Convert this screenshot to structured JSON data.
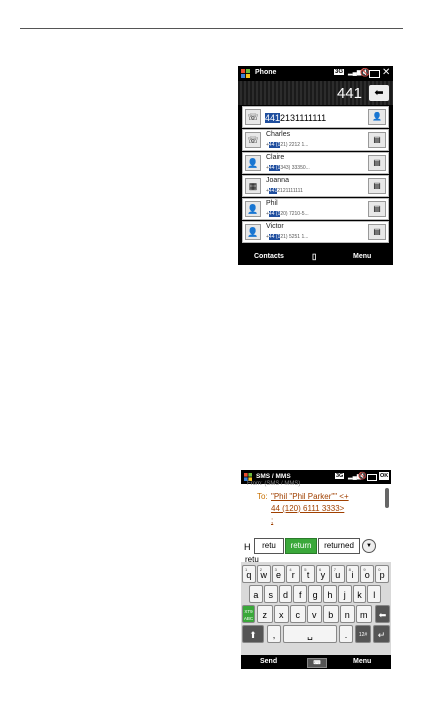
{
  "phone": {
    "status": {
      "title": "Phone",
      "network": "3G",
      "close": "✕"
    },
    "dial": {
      "number": "441",
      "back": "⬅"
    },
    "rows": [
      {
        "pre": "",
        "hl": "441",
        "post": "2131111111",
        "left_icon": "call-icon",
        "right_icon": "add-contact-icon"
      },
      {
        "name": "Charles",
        "pre": "+",
        "hl": "44 (1",
        "post": "21) 2212 1...",
        "left_icon": "call-icon",
        "right_icon": "contact-card-icon"
      },
      {
        "name": "Claire",
        "pre": "+",
        "hl": "44 (1",
        "post": "343) 33350...",
        "left_icon": "person-icon",
        "right_icon": "contact-card-icon"
      },
      {
        "name": "Joanna",
        "pre": "+",
        "hl": "441",
        "post": "2121111111",
        "left_icon": "sim-icon",
        "right_icon": "contact-card-icon"
      },
      {
        "name": "Phil",
        "pre": "+",
        "hl": "44 (1",
        "post": "20) 7210-5...",
        "left_icon": "person-icon",
        "right_icon": "contact-card-icon"
      },
      {
        "name": "Victor",
        "pre": "+",
        "hl": "44 (1",
        "post": "21) 5251 1...",
        "left_icon": "person-icon",
        "right_icon": "contact-card-icon"
      }
    ],
    "bottom": {
      "left": "Contacts",
      "right": "Menu"
    }
  },
  "sms": {
    "status": {
      "title": "SMS / MMS",
      "network": "3G",
      "ok": "OK"
    },
    "from": "From: (SMS / MMS)",
    "to_label": "To:",
    "to_line1": "\"Phil \"Phil Parker\"\" <+",
    "to_line2": "44 (120) 6111 3333>",
    "to_line3": ";",
    "message_prefix": "H",
    "typed": "retu",
    "suggestions": [
      "retu",
      "return",
      "returned"
    ],
    "keyboard": {
      "row1": [
        "q",
        "w",
        "e",
        "r",
        "t",
        "y",
        "u",
        "i",
        "o",
        "p"
      ],
      "row1_nums": [
        "1",
        "2",
        "3",
        "4",
        "5",
        "6",
        "7",
        "8",
        "9",
        "0"
      ],
      "row2": [
        "a",
        "s",
        "d",
        "f",
        "g",
        "h",
        "j",
        "k",
        "l"
      ],
      "row3": [
        "z",
        "x",
        "c",
        "v",
        "b",
        "n",
        "m"
      ],
      "mode_key": "XT9 ABC",
      "shift": "⬆",
      "comma": ",",
      "period": ".",
      "sym": "12#",
      "backspace": "⬅",
      "enter": "↵"
    },
    "bottom": {
      "left": "Send",
      "right": "Menu"
    }
  }
}
